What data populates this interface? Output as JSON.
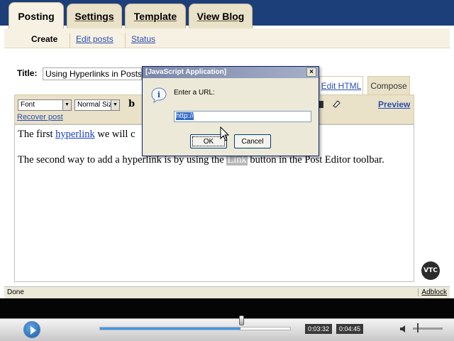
{
  "tabs": {
    "posting": "Posting",
    "settings": "Settings",
    "template": "Template",
    "view_blog": "View Blog"
  },
  "subtabs": {
    "create": "Create",
    "edit_posts": "Edit posts",
    "status": "Status"
  },
  "post": {
    "title_label": "Title:",
    "title_value": "Using Hyperlinks in Posts"
  },
  "mode_tabs": {
    "edit_html": "Edit HTML",
    "compose": "Compose"
  },
  "toolbar": {
    "font": "Font",
    "size": "Normal Size",
    "bold": "b",
    "recover": "Recover post",
    "preview": "Preview"
  },
  "body": {
    "p1_pre": "The first ",
    "p1_link": "hyperlink",
    "p1_post": " we will c",
    "p2_pre": "The second way to add a hyperlink is by using the ",
    "p2_sel": "Link",
    "p2_post": " button in the Post Editor toolbar."
  },
  "logo": "VTC",
  "statusbar": {
    "text": "Done",
    "adblock": "Adblock"
  },
  "dialog": {
    "title": "[JavaScript Application]",
    "close": "×",
    "message": "Enter a URL:",
    "input_value": "http://",
    "ok": "OK",
    "cancel": "Cancel"
  },
  "player": {
    "current_time": "0:03:32",
    "total_time": "0:04:45",
    "progress": 0.74,
    "volume": 0.15
  },
  "colors": {
    "navy_header": "#1c3f7a",
    "tab_tan": "#eae1c9",
    "link_blue": "#2a4fb0"
  }
}
